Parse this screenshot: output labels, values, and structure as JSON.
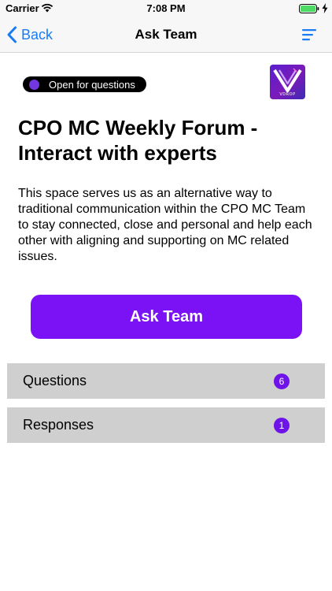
{
  "status_bar": {
    "carrier": "Carrier",
    "time": "7:08 PM",
    "icons": [
      "wifi-icon",
      "battery-icon",
      "charging-bolt-icon"
    ]
  },
  "nav": {
    "back_label": "Back",
    "title": "Ask Team",
    "menu_icon": "menu-icon"
  },
  "status_pill": {
    "label": "Open for questions"
  },
  "logo": {
    "text": "VDROP"
  },
  "page": {
    "title": "CPO MC Weekly Forum - Interact with experts",
    "description": "This space serves us as an alternative way to traditional communication within the CPO MC Team to stay connected, close and personal and help each other with aligning and supporting on MC related issues."
  },
  "actions": {
    "ask_team_label": "Ask Team"
  },
  "lists": [
    {
      "label": "Questions",
      "count": "6"
    },
    {
      "label": "Responses",
      "count": "1"
    }
  ],
  "colors": {
    "accent": "#7b12f5",
    "badge": "#6f14e8",
    "link": "#1a7cf5",
    "row_background": "#cfcfcf"
  }
}
